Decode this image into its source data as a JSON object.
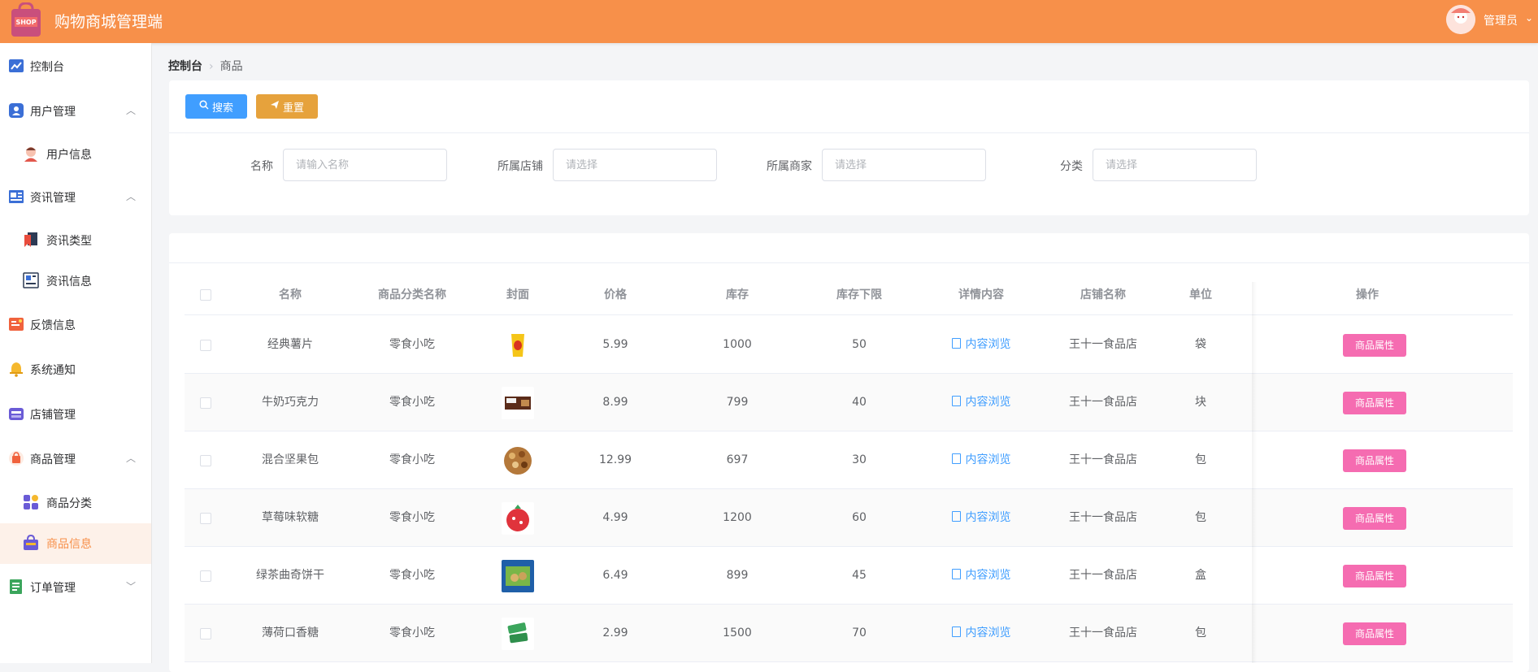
{
  "header": {
    "title": "购物商城管理端",
    "logo_text": "SHOP",
    "user": "管理员",
    "brand_color": "#f7904a"
  },
  "sidebar": {
    "items": [
      {
        "label": "控制台",
        "icon": "chart-line-icon"
      },
      {
        "label": "用户管理",
        "icon": "user-group-icon",
        "expanded": true
      },
      {
        "label": "用户信息",
        "icon": "user-avatar-icon",
        "sub": true
      },
      {
        "label": "资讯管理",
        "icon": "newspaper-icon",
        "expanded": true
      },
      {
        "label": "资讯类型",
        "icon": "bookmark-icon",
        "sub": true
      },
      {
        "label": "资讯信息",
        "icon": "news-card-icon",
        "sub": true
      },
      {
        "label": "反馈信息",
        "icon": "feedback-icon"
      },
      {
        "label": "系统通知",
        "icon": "bell-icon"
      },
      {
        "label": "店铺管理",
        "icon": "store-icon"
      },
      {
        "label": "商品管理",
        "icon": "shopping-bag-icon",
        "expanded": true
      },
      {
        "label": "商品分类",
        "icon": "category-icon",
        "sub": true
      },
      {
        "label": "商品信息",
        "icon": "goods-icon",
        "sub": true,
        "active": true
      },
      {
        "label": "订单管理",
        "icon": "order-icon",
        "expanded": false
      }
    ]
  },
  "breadcrumb": {
    "root": "控制台",
    "current": "商品"
  },
  "search": {
    "search_label": "搜索",
    "reset_label": "重置",
    "fields": [
      {
        "label": "名称",
        "placeholder": "请输入名称"
      },
      {
        "label": "所属店铺",
        "placeholder": "请选择"
      },
      {
        "label": "所属商家",
        "placeholder": "请选择"
      },
      {
        "label": "分类",
        "placeholder": "请选择"
      }
    ]
  },
  "table": {
    "columns": [
      "名称",
      "商品分类名称",
      "封面",
      "价格",
      "库存",
      "库存下限",
      "详情内容",
      "店铺名称",
      "单位",
      "操作"
    ],
    "rows": [
      {
        "name": "经典薯片",
        "category": "零食小吃",
        "price": "5.99",
        "stock": "1000",
        "min_stock": "50",
        "detail": "内容浏览",
        "shop": "王十一食品店",
        "unit": "袋",
        "op": "商品属性"
      },
      {
        "name": "牛奶巧克力",
        "category": "零食小吃",
        "price": "8.99",
        "stock": "799",
        "min_stock": "40",
        "detail": "内容浏览",
        "shop": "王十一食品店",
        "unit": "块",
        "op": "商品属性"
      },
      {
        "name": "混合坚果包",
        "category": "零食小吃",
        "price": "12.99",
        "stock": "697",
        "min_stock": "30",
        "detail": "内容浏览",
        "shop": "王十一食品店",
        "unit": "包",
        "op": "商品属性"
      },
      {
        "name": "草莓味软糖",
        "category": "零食小吃",
        "price": "4.99",
        "stock": "1200",
        "min_stock": "60",
        "detail": "内容浏览",
        "shop": "王十一食品店",
        "unit": "包",
        "op": "商品属性"
      },
      {
        "name": "绿茶曲奇饼干",
        "category": "零食小吃",
        "price": "6.49",
        "stock": "899",
        "min_stock": "45",
        "detail": "内容浏览",
        "shop": "王十一食品店",
        "unit": "盒",
        "op": "商品属性"
      },
      {
        "name": "薄荷口香糖",
        "category": "零食小吃",
        "price": "2.99",
        "stock": "1500",
        "min_stock": "70",
        "detail": "内容浏览",
        "shop": "王十一食品店",
        "unit": "包",
        "op": "商品属性"
      }
    ]
  },
  "colors": {
    "primary": "#409eff",
    "warning": "#e6a23c",
    "pink": "#f56cb1"
  }
}
